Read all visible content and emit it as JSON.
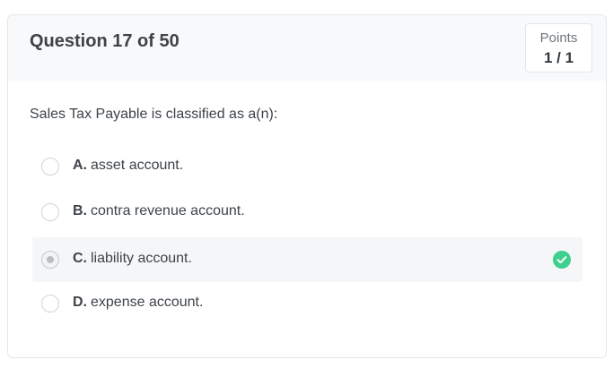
{
  "question": {
    "title": "Question 17 of 50",
    "points_label": "Points",
    "points_value": "1 / 1",
    "text": "Sales Tax Payable is classified as a(n):"
  },
  "options": [
    {
      "letter": "A.",
      "text": "asset account.",
      "selected": false,
      "correct": false
    },
    {
      "letter": "B.",
      "text": "contra revenue account.",
      "selected": false,
      "correct": false
    },
    {
      "letter": "C.",
      "text": "liability account.",
      "selected": true,
      "correct": true
    },
    {
      "letter": "D.",
      "text": "expense account.",
      "selected": false,
      "correct": false
    }
  ],
  "colors": {
    "correct": "#3ecf8e",
    "header_bg": "#f8f9fa",
    "selected_bg": "#f5f6f7"
  },
  "icons": {
    "correct": "check-circle-icon"
  }
}
